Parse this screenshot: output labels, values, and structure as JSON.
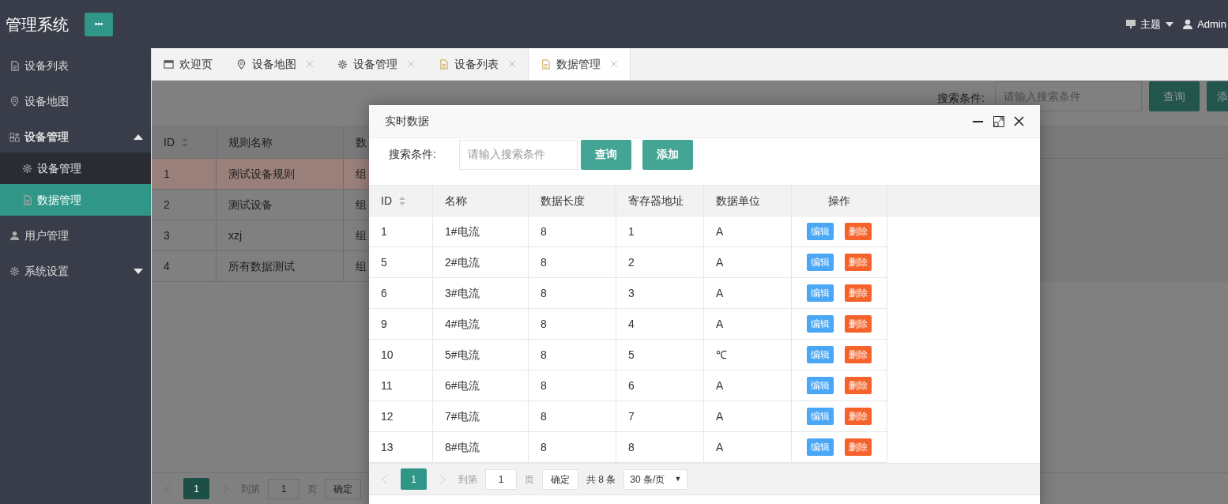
{
  "header": {
    "title": "管理系统",
    "menu_button": "•••",
    "theme": "主题",
    "user": "Admin"
  },
  "sidebar": {
    "items": [
      {
        "label": "设备列表",
        "kind": "doc",
        "selected": false
      },
      {
        "label": "设备地图",
        "kind": "pin",
        "selected": false
      },
      {
        "label": "设备管理",
        "kind": "grid",
        "expanded": true,
        "selected": false,
        "children": [
          {
            "label": "设备管理",
            "kind": "gear",
            "selected": false
          },
          {
            "label": "数据管理",
            "kind": "doc",
            "selected": true
          }
        ]
      },
      {
        "label": "用户管理",
        "kind": "user",
        "selected": false
      },
      {
        "label": "系统设置",
        "kind": "gear",
        "expanded": false,
        "selected": false
      }
    ]
  },
  "tabs": [
    {
      "label": "欢迎页",
      "kind": "window",
      "closable": false,
      "selected": false
    },
    {
      "label": "设备地图",
      "kind": "pin",
      "closable": true,
      "selected": false
    },
    {
      "label": "设备管理",
      "kind": "gear",
      "closable": true,
      "selected": false
    },
    {
      "label": "设备列表",
      "kind": "doc",
      "closable": true,
      "selected": false
    },
    {
      "label": "数据管理",
      "kind": "doc",
      "closable": true,
      "selected": true
    }
  ],
  "page": {
    "search_label": "搜索条件:",
    "search_placeholder": "请输入搜索条件",
    "query_button": "查询",
    "add_button": "添",
    "table": {
      "columns": [
        "ID",
        "规则名称",
        "数"
      ],
      "rows": [
        {
          "cells": [
            "1",
            "测试设备规则",
            "组"
          ],
          "selected": true
        },
        {
          "cells": [
            "2",
            "测试设备",
            "组"
          ],
          "selected": false
        },
        {
          "cells": [
            "3",
            "xzj",
            "组"
          ],
          "selected": false
        },
        {
          "cells": [
            "4",
            "所有数据测试",
            "组"
          ],
          "selected": false
        }
      ]
    },
    "pagination": {
      "page": "1",
      "goto_label": "到第",
      "goto_value": "1",
      "page_unit": "页",
      "confirm": "确定"
    }
  },
  "dialog": {
    "title": "实时数据",
    "search_label": "搜索条件:",
    "search_placeholder": "请输入搜索条件",
    "query_button": "查询",
    "add_button": "添加",
    "table": {
      "columns": [
        "ID",
        "名称",
        "数据长度",
        "寄存器地址",
        "数据单位",
        "操作"
      ],
      "rows": [
        {
          "cells": [
            "1",
            "1#电流",
            "8",
            "1",
            "A"
          ],
          "edit_button": "编辑",
          "delete_button": "删除"
        },
        {
          "cells": [
            "5",
            "2#电流",
            "8",
            "2",
            "A"
          ],
          "edit_button": "编辑",
          "delete_button": "删除"
        },
        {
          "cells": [
            "6",
            "3#电流",
            "8",
            "3",
            "A"
          ],
          "edit_button": "编辑",
          "delete_button": "删除"
        },
        {
          "cells": [
            "9",
            "4#电流",
            "8",
            "4",
            "A"
          ],
          "edit_button": "编辑",
          "delete_button": "删除"
        },
        {
          "cells": [
            "10",
            "5#电流",
            "8",
            "5",
            "℃"
          ],
          "edit_button": "编辑",
          "delete_button": "删除"
        },
        {
          "cells": [
            "11",
            "6#电流",
            "8",
            "6",
            "A"
          ],
          "edit_button": "编辑",
          "delete_button": "删除"
        },
        {
          "cells": [
            "12",
            "7#电流",
            "8",
            "7",
            "A"
          ],
          "edit_button": "编辑",
          "delete_button": "删除"
        },
        {
          "cells": [
            "13",
            "8#电流",
            "8",
            "8",
            "A"
          ],
          "edit_button": "编辑",
          "delete_button": "删除"
        }
      ]
    },
    "pagination": {
      "page": "1",
      "goto_label": "到第",
      "goto_value": "1",
      "page_unit": "页",
      "confirm": "确定",
      "total": "共 8 条",
      "page_size": "30 条/页",
      "page_size_caret": "▼"
    }
  }
}
